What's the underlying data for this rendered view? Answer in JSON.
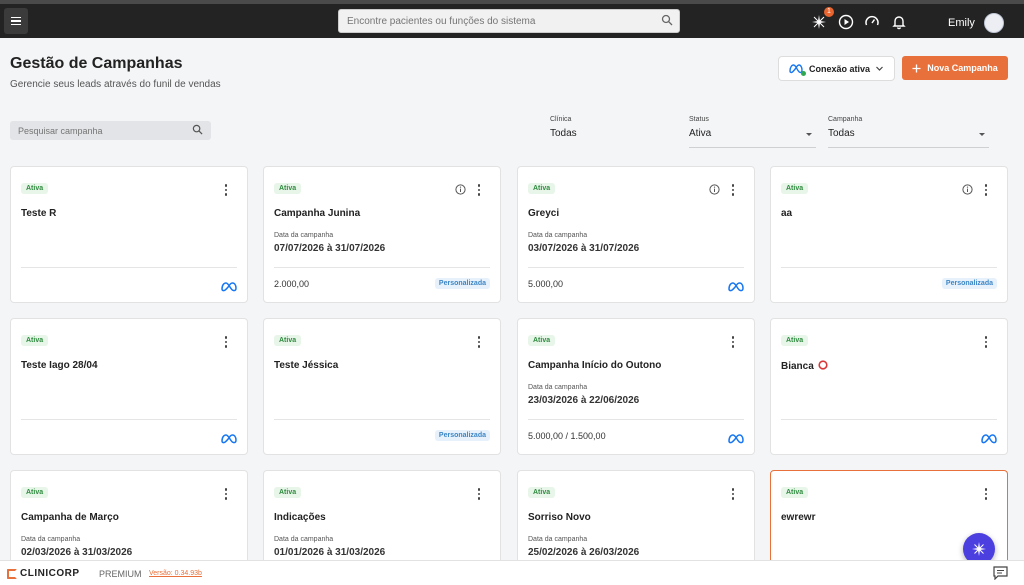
{
  "topbar": {
    "search_placeholder": "Encontre pacientes ou funções do sistema",
    "notification_badge": "1",
    "user_name": "Emily"
  },
  "header": {
    "title": "Gestão de Campanhas",
    "subtitle": "Gerencie seus leads através do funil de vendas",
    "connection_label": "Conexão ativa",
    "new_campaign_label": "Nova Campanha"
  },
  "filters": {
    "search_placeholder": "Pesquisar campanha",
    "clinic": {
      "label": "Clínica",
      "value": "Todas"
    },
    "status": {
      "label": "Status",
      "value": "Ativa"
    },
    "campaign": {
      "label": "Campanha",
      "value": "Todas"
    }
  },
  "cards": [
    {
      "status": "Ativa",
      "name": "Teste R",
      "date_label": "",
      "date": "",
      "value": "",
      "tag": "",
      "meta": true,
      "info": false
    },
    {
      "status": "Ativa",
      "name": "Campanha Junina",
      "date_label": "Data da campanha",
      "date": "07/07/2026 à 31/07/2026",
      "value": "2.000,00",
      "tag": "Personalizada",
      "meta": false,
      "info": true
    },
    {
      "status": "Ativa",
      "name": "Greyci",
      "date_label": "Data da campanha",
      "date": "03/07/2026 à 31/07/2026",
      "value": "5.000,00",
      "tag": "",
      "meta": true,
      "info": true
    },
    {
      "status": "Ativa",
      "name": "aa",
      "date_label": "",
      "date": "",
      "value": "",
      "tag": "Personalizada",
      "meta": false,
      "info": true
    },
    {
      "status": "Ativa",
      "name": "Teste Iago 28/04",
      "date_label": "",
      "date": "",
      "value": "",
      "tag": "",
      "meta": true,
      "info": false
    },
    {
      "status": "Ativa",
      "name": "Teste Jéssica",
      "date_label": "",
      "date": "",
      "value": "",
      "tag": "Personalizada",
      "meta": false,
      "info": false
    },
    {
      "status": "Ativa",
      "name": "Campanha Início do Outono",
      "date_label": "Data da campanha",
      "date": "23/03/2026 à 22/06/2026",
      "value": "5.000,00 / 1.500,00",
      "tag": "",
      "meta": true,
      "info": false
    },
    {
      "status": "Ativa",
      "name": "Bianca",
      "date_label": "",
      "date": "",
      "value": "",
      "tag": "",
      "meta": true,
      "info": false,
      "ring": true
    },
    {
      "status": "Ativa",
      "name": "Campanha de Março",
      "date_label": "Data da campanha",
      "date": "02/03/2026 à 31/03/2026",
      "value": "",
      "tag": "",
      "meta": false,
      "info": false
    },
    {
      "status": "Ativa",
      "name": "Indicações",
      "date_label": "Data da campanha",
      "date": "01/01/2026 à 31/03/2026",
      "value": "",
      "tag": "",
      "meta": false,
      "info": false
    },
    {
      "status": "Ativa",
      "name": "Sorriso Novo",
      "date_label": "Data da campanha",
      "date": "25/02/2026 à 26/03/2026",
      "value": "",
      "tag": "",
      "meta": false,
      "info": false
    },
    {
      "status": "Ativa",
      "name": "ewrewr",
      "date_label": "",
      "date": "",
      "value": "",
      "tag": "",
      "meta": false,
      "info": false,
      "highlight": true
    }
  ],
  "footer": {
    "logo_text": "CLINICORP",
    "plan": "PREMIUM",
    "version": "Versão: 0.34.93b"
  },
  "colors": {
    "accent": "#e8703a",
    "topbar": "#232323",
    "status_green": "#2e8b3e",
    "tag_blue": "#3d86c6",
    "meta_blue": "#1877f2",
    "fab": "#4b3fe0"
  }
}
